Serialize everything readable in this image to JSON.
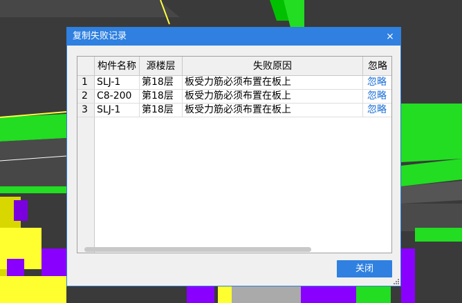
{
  "dialog": {
    "title": "复制失败记录",
    "close_label": "×",
    "close_button_label": "关闭"
  },
  "table": {
    "columns": [
      "构件名称",
      "源楼层",
      "失败原因",
      "忽略"
    ],
    "rows": [
      {
        "num": "1",
        "name": "SLJ-1",
        "floor": "第18层",
        "reason": "板受力筋必须布置在板上",
        "action": "忽略"
      },
      {
        "num": "2",
        "name": "C8-200",
        "floor": "第18层",
        "reason": "板受力筋必须布置在板上",
        "action": "忽略"
      },
      {
        "num": "3",
        "name": "SLJ-1",
        "floor": "第18层",
        "reason": "板受力筋必须布置在板上",
        "action": "忽略"
      }
    ]
  },
  "colors": {
    "accent": "#2f80e0",
    "link": "#1a6fd6"
  }
}
